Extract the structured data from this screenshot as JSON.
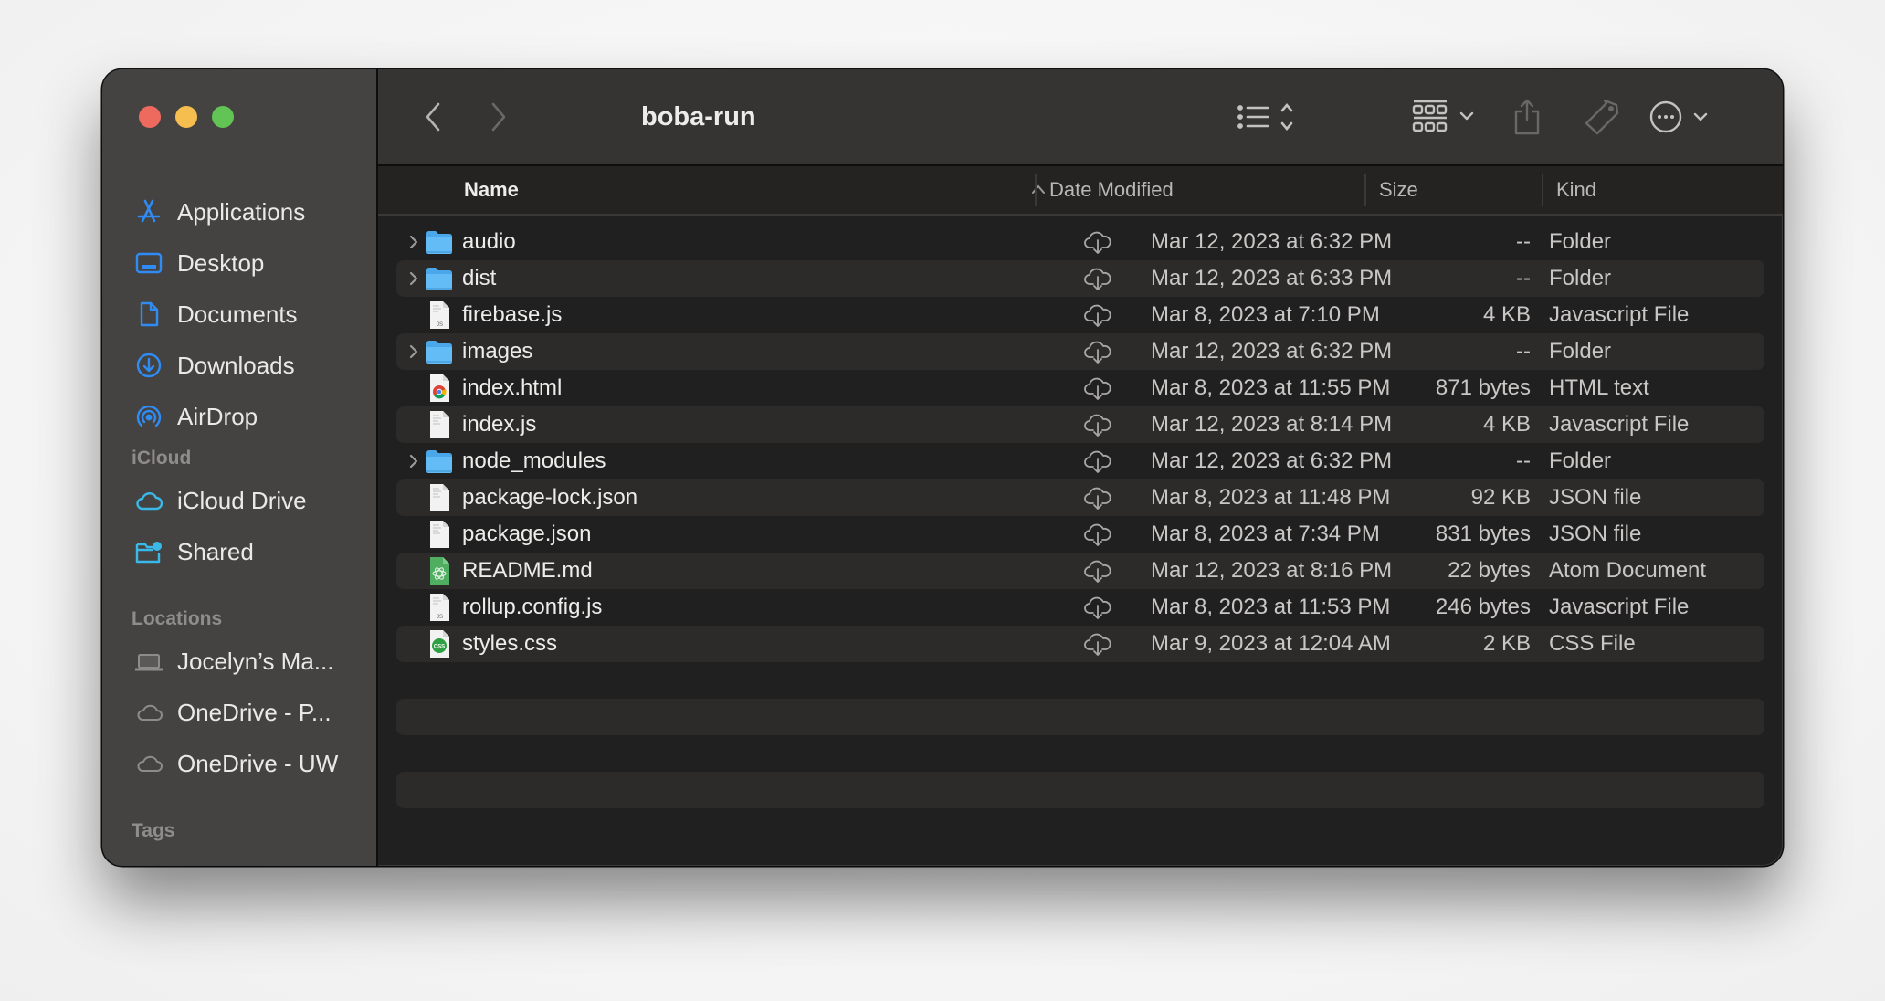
{
  "window": {
    "title": "boba-run",
    "traffic_lights": {
      "close": "#ee6a5f",
      "minimize": "#f5be4f",
      "zoom": "#61c454"
    }
  },
  "toolbar": {
    "back_icon": "chevron-left-icon",
    "forward_icon": "chevron-right-icon",
    "view_icon": "list-view-icon",
    "group_icon": "group-grid-icon",
    "share_icon": "share-icon",
    "tag_icon": "tag-icon",
    "more_icon": "ellipsis-circle-icon",
    "search_icon": "search-icon"
  },
  "sidebar": {
    "favorites": [
      {
        "label": "Applications",
        "icon": "applications-icon"
      },
      {
        "label": "Desktop",
        "icon": "desktop-icon"
      },
      {
        "label": "Documents",
        "icon": "documents-icon"
      },
      {
        "label": "Downloads",
        "icon": "downloads-icon"
      },
      {
        "label": "AirDrop",
        "icon": "airdrop-icon"
      }
    ],
    "icloud_header": "iCloud",
    "icloud": [
      {
        "label": "iCloud Drive",
        "icon": "icloud-icon"
      },
      {
        "label": "Shared",
        "icon": "shared-folder-icon"
      }
    ],
    "locations_header": "Locations",
    "locations": [
      {
        "label": "Jocelyn’s Ma...",
        "icon": "laptop-icon"
      },
      {
        "label": "OneDrive - P...",
        "icon": "cloud-icon"
      },
      {
        "label": "OneDrive - UW",
        "icon": "cloud-icon"
      }
    ],
    "tags_header": "Tags",
    "accent_color": "#2f8cf5"
  },
  "columns": {
    "name": "Name",
    "date": "Date Modified",
    "size": "Size",
    "kind": "Kind",
    "sort": "ascending"
  },
  "files": [
    {
      "name": "audio",
      "date": "Mar 12, 2023 at 6:32 PM",
      "size": "--",
      "kind": "Folder",
      "type": "folder"
    },
    {
      "name": "dist",
      "date": "Mar 12, 2023 at 6:33 PM",
      "size": "--",
      "kind": "Folder",
      "type": "folder"
    },
    {
      "name": "firebase.js",
      "date": "Mar 8, 2023 at 7:10 PM",
      "size": "4 KB",
      "kind": "Javascript File",
      "type": "js"
    },
    {
      "name": "images",
      "date": "Mar 12, 2023 at 6:32 PM",
      "size": "--",
      "kind": "Folder",
      "type": "folder"
    },
    {
      "name": "index.html",
      "date": "Mar 8, 2023 at 11:55 PM",
      "size": "871 bytes",
      "kind": "HTML text",
      "type": "html"
    },
    {
      "name": "index.js",
      "date": "Mar 12, 2023 at 8:14 PM",
      "size": "4 KB",
      "kind": "Javascript File",
      "type": "doc"
    },
    {
      "name": "node_modules",
      "date": "Mar 12, 2023 at 6:32 PM",
      "size": "--",
      "kind": "Folder",
      "type": "folder"
    },
    {
      "name": "package-lock.json",
      "date": "Mar 8, 2023 at 11:48 PM",
      "size": "92 KB",
      "kind": "JSON file",
      "type": "doc"
    },
    {
      "name": "package.json",
      "date": "Mar 8, 2023 at 7:34 PM",
      "size": "831 bytes",
      "kind": "JSON file",
      "type": "doc"
    },
    {
      "name": "README.md",
      "date": "Mar 12, 2023 at 8:16 PM",
      "size": "22 bytes",
      "kind": "Atom Document",
      "type": "atom"
    },
    {
      "name": "rollup.config.js",
      "date": "Mar 8, 2023 at 11:53 PM",
      "size": "246 bytes",
      "kind": "Javascript File",
      "type": "js"
    },
    {
      "name": "styles.css",
      "date": "Mar 9, 2023 at 12:04 AM",
      "size": "2 KB",
      "kind": "CSS File",
      "type": "css"
    }
  ]
}
